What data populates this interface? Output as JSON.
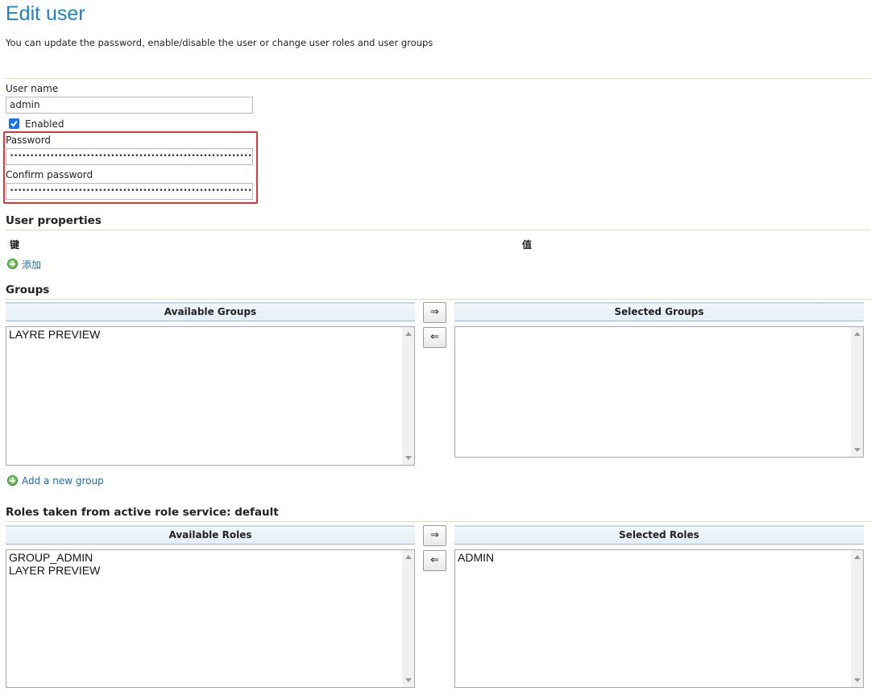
{
  "page": {
    "title": "Edit user",
    "subtitle": "You can update the password, enable/disable the user or change user roles and user groups"
  },
  "form": {
    "username_label": "User name",
    "username_value": "admin",
    "enabled_label": "Enabled",
    "enabled_checked": true,
    "password_label": "Password",
    "password_value": "•••••••••••••••••••••••••••••••••••••••••••••••••••••••••••••••••••••••",
    "confirm_label": "Confirm password",
    "confirm_value": "•••••••••••••••••••••••••••••••••••••••••••••••••••••••••••••••••••••••"
  },
  "properties": {
    "title": "User properties",
    "key_header": "键",
    "value_header": "值",
    "add_label": "添加"
  },
  "groups": {
    "title": "Groups",
    "available_header": "Available Groups",
    "selected_header": "Selected Groups",
    "available": [
      "LAYRE PREVIEW"
    ],
    "selected": [],
    "add_button_right": "⇒",
    "add_button_left": "⇐",
    "add_group_link": "Add a new group"
  },
  "roles": {
    "title": "Roles taken from active role service: default",
    "available_header": "Available Roles",
    "selected_header": "Selected Roles",
    "available": [
      "GROUP_ADMIN",
      "LAYER PREVIEW"
    ],
    "selected": [
      "ADMIN"
    ],
    "add_button_right": "⇒",
    "add_button_left": "⇐"
  },
  "colors": {
    "title_blue": "#1c84c6",
    "highlight_red": "#e0333a",
    "checkbox_blue": "#1a73e8",
    "link_blue": "#1b6aa5"
  }
}
